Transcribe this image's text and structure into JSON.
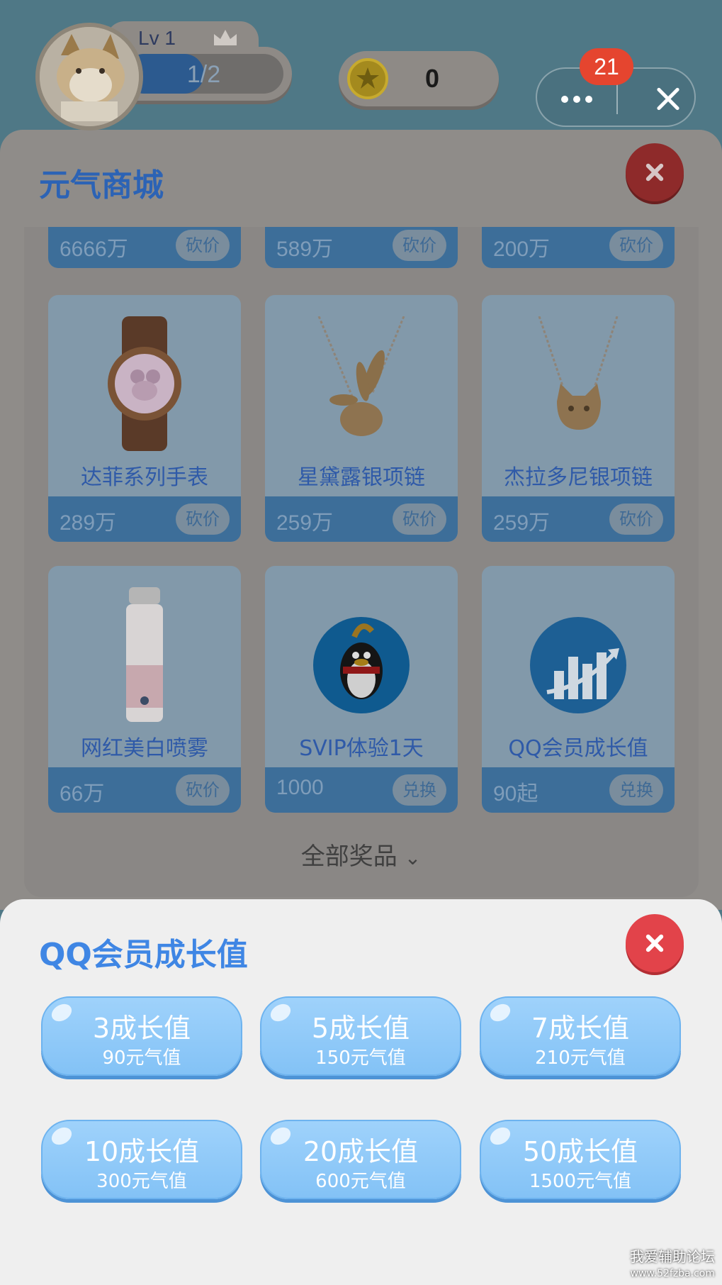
{
  "top_bar": {
    "level": "Lv 1",
    "progress_text": "1/2",
    "progress_fraction": 0.5,
    "coins": "0",
    "notification_count": "21",
    "icons": [
      "avatar",
      "crown-icon",
      "coin-icon",
      "more-icon",
      "close-icon"
    ]
  },
  "store": {
    "title": "元气商城",
    "show_all_label": "全部奖品",
    "partial_row": [
      {
        "price": "6666万",
        "action": "砍价"
      },
      {
        "price": "589万",
        "action": "砍价"
      },
      {
        "price": "200万",
        "action": "砍价"
      }
    ],
    "items": [
      {
        "name": "达菲系列手表",
        "price": "289万",
        "action": "砍价",
        "icon": "watch-icon"
      },
      {
        "name": "星黛露银项链",
        "price": "259万",
        "action": "砍价",
        "icon": "bunny-necklace-icon"
      },
      {
        "name": "杰拉多尼银项链",
        "price": "259万",
        "action": "砍价",
        "icon": "cat-necklace-icon"
      },
      {
        "name": "网红美白喷雾",
        "price": "66万",
        "action": "砍价",
        "icon": "spray-bottle-icon"
      },
      {
        "name": "SVIP体验1天",
        "price": "1000",
        "action": "兑换",
        "icon": "qq-penguin-icon"
      },
      {
        "name": "QQ会员成长值",
        "price": "90起",
        "action": "兑换",
        "icon": "growth-chart-icon"
      }
    ]
  },
  "sheet": {
    "title": "QQ会员成长值",
    "options": [
      {
        "label": "3成长值",
        "cost": "90元气值"
      },
      {
        "label": "5成长值",
        "cost": "150元气值"
      },
      {
        "label": "7成长值",
        "cost": "210元气值"
      },
      {
        "label": "10成长值",
        "cost": "300元气值"
      },
      {
        "label": "20成长值",
        "cost": "600元气值"
      },
      {
        "label": "50成长值",
        "cost": "1500元气值"
      }
    ]
  },
  "watermark": {
    "line1": "我爱辅助论坛",
    "line2": "www.52fzba.com"
  },
  "colors": {
    "accent_blue": "#3f86e4",
    "close_red": "#e2434a",
    "badge_red": "#e5452f"
  }
}
